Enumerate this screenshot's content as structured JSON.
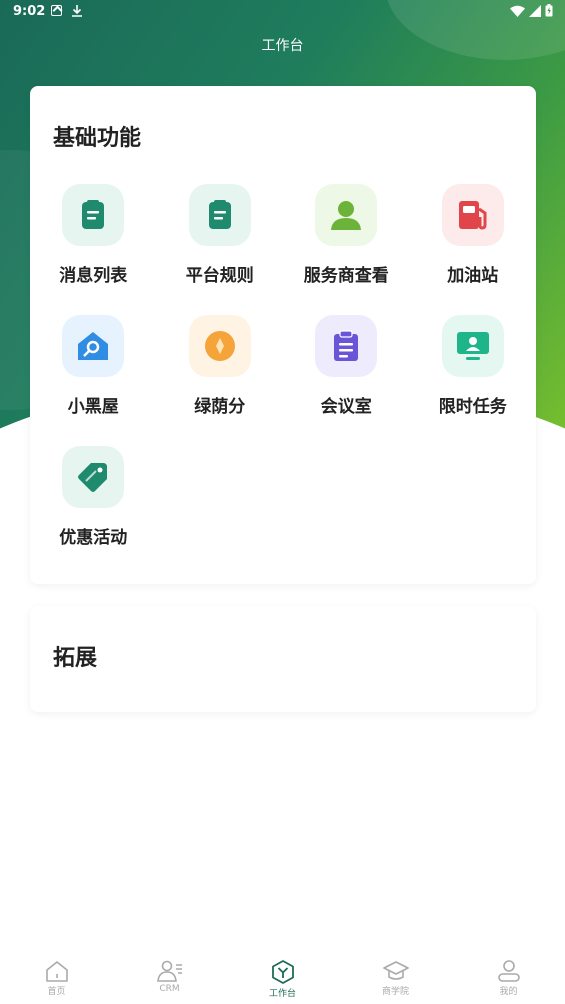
{
  "status_bar": {
    "time": "9:02"
  },
  "header": {
    "title": "工作台"
  },
  "basic": {
    "title": "基础功能",
    "items": [
      {
        "label": "消息列表",
        "icon": "message-list-icon",
        "bg": "#e7f5f1",
        "color": "#1f8a6d"
      },
      {
        "label": "平台规则",
        "icon": "platform-rules-icon",
        "bg": "#e7f5f1",
        "color": "#1f8a6d"
      },
      {
        "label": "服务商查看",
        "icon": "provider-person-icon",
        "bg": "#eef8e6",
        "color": "#6cb33a"
      },
      {
        "label": "加油站",
        "icon": "gas-station-icon",
        "bg": "#fdebeb",
        "color": "#e0454a"
      },
      {
        "label": "小黑屋",
        "icon": "house-key-icon",
        "bg": "#e6f2fd",
        "color": "#2f8de4"
      },
      {
        "label": "绿荫分",
        "icon": "coin-icon",
        "bg": "#fff3e4",
        "color": "#f5a43a"
      },
      {
        "label": "会议室",
        "icon": "clipboard-icon",
        "bg": "#eeebfc",
        "color": "#6a55d9"
      },
      {
        "label": "限时任务",
        "icon": "monitor-icon",
        "bg": "#e4f7f1",
        "color": "#1eb58a"
      },
      {
        "label": "优惠活动",
        "icon": "coupon-tag-icon",
        "bg": "#e7f5f1",
        "color": "#1f8a6d"
      }
    ]
  },
  "extension": {
    "title": "拓展"
  },
  "tabbar": {
    "tabs": [
      {
        "label": "首页",
        "icon": "home-icon"
      },
      {
        "label": "CRM",
        "icon": "crm-icon"
      },
      {
        "label": "工作台",
        "icon": "workbench-icon"
      },
      {
        "label": "商学院",
        "icon": "academy-icon"
      },
      {
        "label": "我的",
        "icon": "profile-icon"
      }
    ],
    "active_color": "#1d6b55",
    "inactive_color": "#aaaaaa"
  }
}
